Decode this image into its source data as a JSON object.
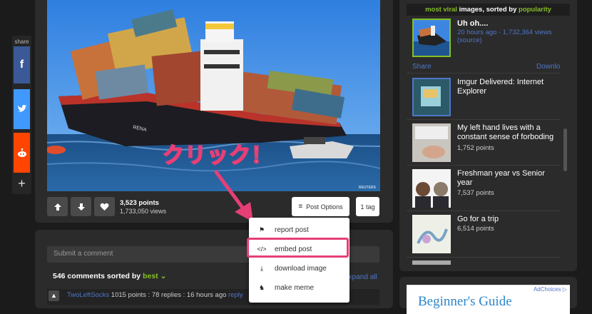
{
  "share": {
    "label": "share"
  },
  "post": {
    "points": "3,523 points",
    "views": "1,733,050 views",
    "options_label": "Post Options",
    "tag_label": "1 tag",
    "annotation": "クリック！"
  },
  "popup": {
    "items": [
      "report post",
      "embed post",
      "download image",
      "make meme"
    ]
  },
  "comments": {
    "placeholder": "Submit a comment",
    "count": "546 comments sorted by",
    "sort": "best",
    "expand": "Expand all",
    "first": {
      "user": "TwoLeftSocks",
      "meta": "1015 points : 78 replies : 16 hours ago",
      "reply": "reply"
    }
  },
  "sidebar": {
    "head": {
      "a": "most viral",
      "b": " images, sorted by ",
      "c": "popularity"
    },
    "featured": {
      "title": "Uh oh....",
      "meta": "20 hours ago · 1,732,364 views",
      "source": "(source)",
      "share": "Share",
      "download": "Download"
    },
    "items": [
      {
        "title": "Imgur Delivered: Internet Explorer",
        "points": ""
      },
      {
        "title": "My left hand lives with a constant sense of forboding",
        "points": "1,752 points"
      },
      {
        "title": "Freshman year vs Senior year",
        "points": "7,537 points"
      },
      {
        "title": "Go for a trip",
        "points": "6,514 points"
      }
    ],
    "ad": {
      "choices": "AdChoices",
      "text": "Beginner's Guide"
    }
  },
  "colors": {
    "highlight": "#e63f76",
    "accent_green": "#85bf25",
    "link_blue": "#4e76c9"
  }
}
